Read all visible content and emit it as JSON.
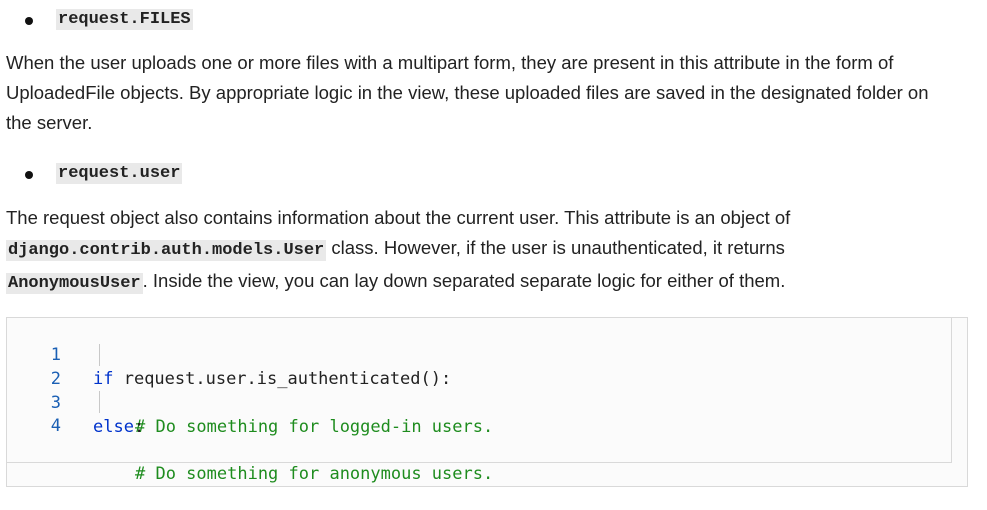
{
  "bullets": [
    {
      "code": "request.FILES"
    },
    {
      "code": "request.user"
    }
  ],
  "paragraphs": {
    "files": {
      "line1": "When the user uploads one or more files with a multipart form, they are present in this attribute in the form of",
      "line2": "UploadedFile objects. By appropriate logic in the view, these uploaded files are saved in the designated folder on",
      "line3": "the server."
    },
    "user": {
      "line1": "The request object also contains information about the current user. This attribute is an object of",
      "line2_code": "django.contrib.auth.models.User",
      "line2_text": " class. However, if the user is unauthenticated, it returns",
      "line3_code": "AnonymousUser",
      "line3_text": ". Inside the view, you can lay down separated separate logic for either of them."
    }
  },
  "code_block": {
    "lines": [
      {
        "num": "1",
        "keyword": "if",
        "text": " request.user.is_authenticated():",
        "comment": ""
      },
      {
        "num": "2",
        "keyword": "",
        "text": "",
        "comment": "# Do something for logged-in users."
      },
      {
        "num": "3",
        "keyword": "else",
        "text": ":",
        "comment": ""
      },
      {
        "num": "4",
        "keyword": "",
        "text": "",
        "comment": "# Do something for anonymous users."
      }
    ]
  }
}
